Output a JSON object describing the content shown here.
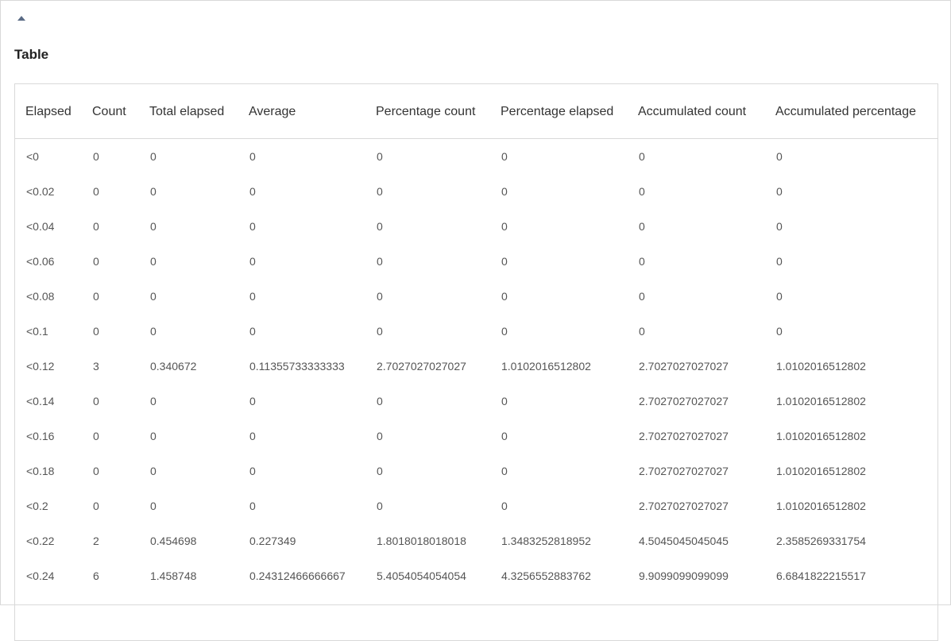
{
  "panel": {
    "toggle_icon": "triangle-up-icon",
    "title": "Table"
  },
  "table": {
    "headers": [
      "Elapsed",
      "Count",
      "Total elapsed",
      "Average",
      "Percentage count",
      "Percentage elapsed",
      "Accumulated count",
      "Accumulated percentage"
    ],
    "rows": [
      [
        "<0",
        "0",
        "0",
        "0",
        "0",
        "0",
        "0",
        "0"
      ],
      [
        "<0.02",
        "0",
        "0",
        "0",
        "0",
        "0",
        "0",
        "0"
      ],
      [
        "<0.04",
        "0",
        "0",
        "0",
        "0",
        "0",
        "0",
        "0"
      ],
      [
        "<0.06",
        "0",
        "0",
        "0",
        "0",
        "0",
        "0",
        "0"
      ],
      [
        "<0.08",
        "0",
        "0",
        "0",
        "0",
        "0",
        "0",
        "0"
      ],
      [
        "<0.1",
        "0",
        "0",
        "0",
        "0",
        "0",
        "0",
        "0"
      ],
      [
        "<0.12",
        "3",
        "0.340672",
        "0.11355733333333",
        "2.7027027027027",
        "1.0102016512802",
        "2.7027027027027",
        "1.0102016512802"
      ],
      [
        "<0.14",
        "0",
        "0",
        "0",
        "0",
        "0",
        "2.7027027027027",
        "1.0102016512802"
      ],
      [
        "<0.16",
        "0",
        "0",
        "0",
        "0",
        "0",
        "2.7027027027027",
        "1.0102016512802"
      ],
      [
        "<0.18",
        "0",
        "0",
        "0",
        "0",
        "0",
        "2.7027027027027",
        "1.0102016512802"
      ],
      [
        "<0.2",
        "0",
        "0",
        "0",
        "0",
        "0",
        "2.7027027027027",
        "1.0102016512802"
      ],
      [
        "<0.22",
        "2",
        "0.454698",
        "0.227349",
        "1.8018018018018",
        "1.3483252818952",
        "4.5045045045045",
        "2.3585269331754"
      ],
      [
        "<0.24",
        "6",
        "1.458748",
        "0.24312466666667",
        "5.4054054054054",
        "4.3256552883762",
        "9.9099099099099",
        "6.6841822215517"
      ]
    ]
  }
}
